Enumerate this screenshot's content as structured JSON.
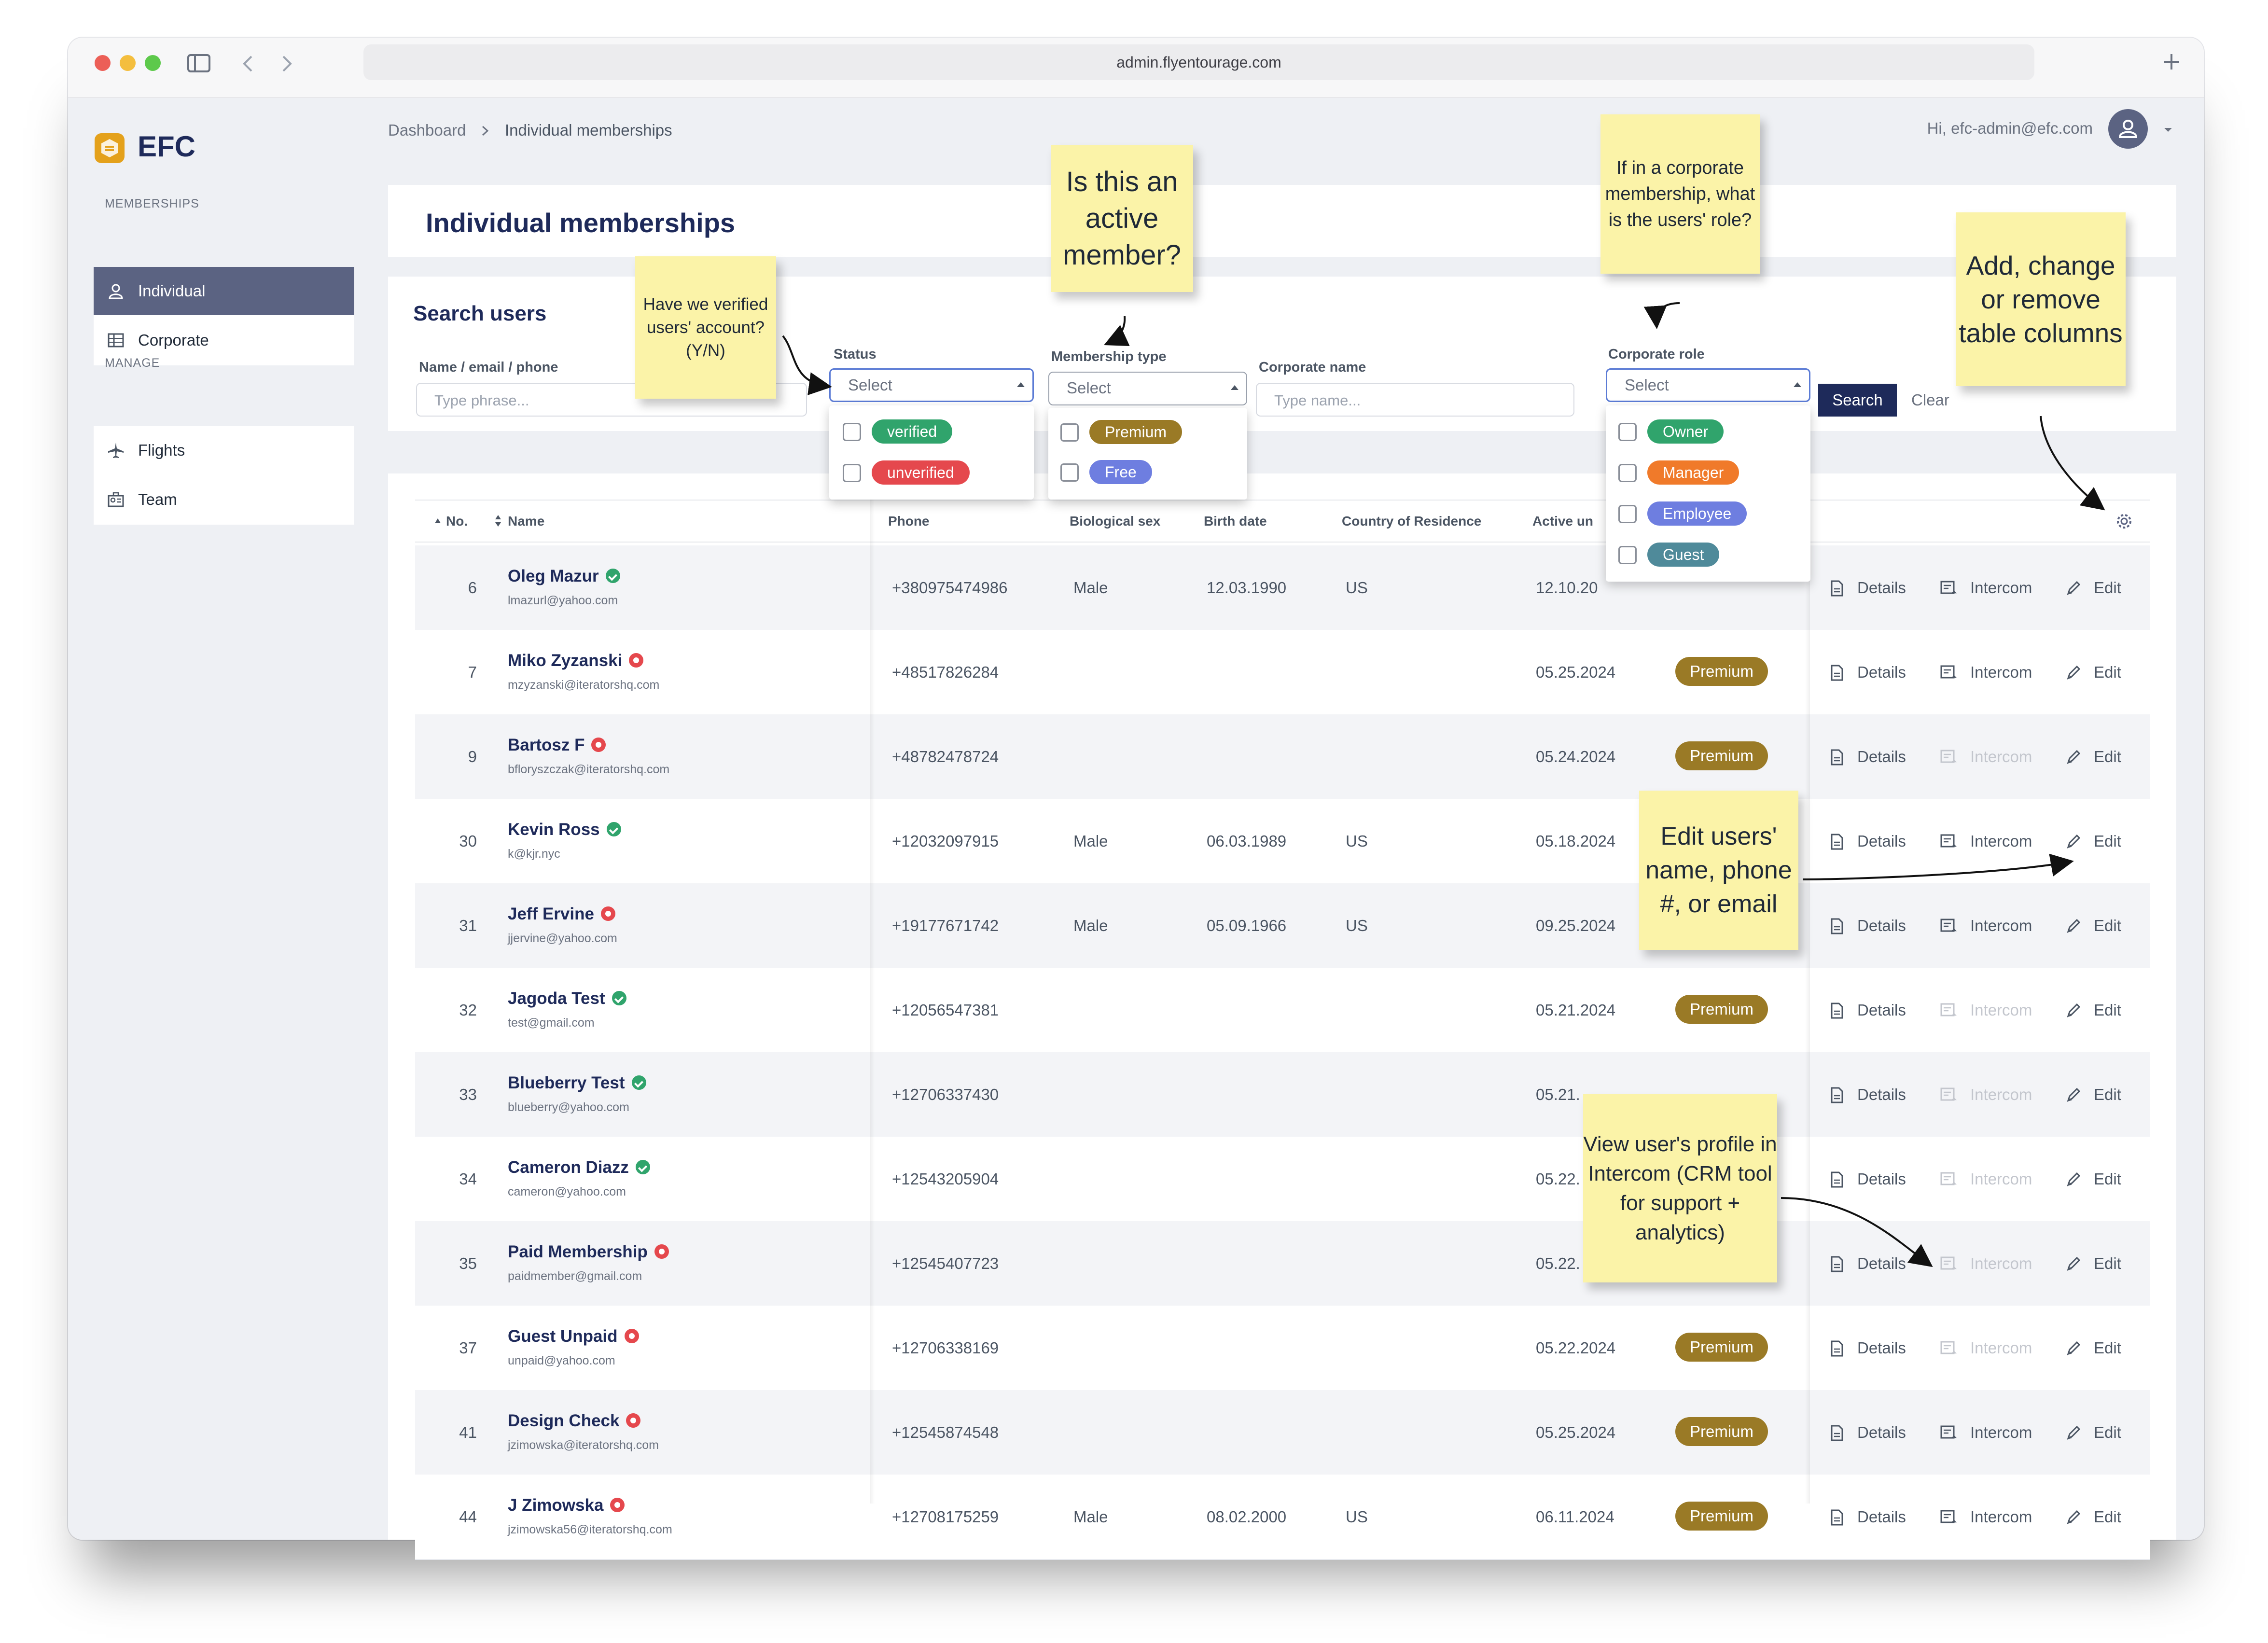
{
  "browser": {
    "url": "admin.flyentourage.com"
  },
  "brand": {
    "name": "EFC"
  },
  "sidebar": {
    "memberships_caption": "MEMBERSHIPS",
    "manage_caption": "MANAGE",
    "items": [
      {
        "label": "Individual",
        "icon": "person-icon",
        "active": true
      },
      {
        "label": "Corporate",
        "icon": "building-icon",
        "active": false
      },
      {
        "label": "Flights",
        "icon": "plane-icon",
        "active": false
      },
      {
        "label": "Team",
        "icon": "team-icon",
        "active": false
      }
    ]
  },
  "header": {
    "breadcrumb": [
      "Dashboard",
      "Individual memberships"
    ],
    "greeting": "Hi, efc-admin@efc.com"
  },
  "page": {
    "title": "Individual memberships"
  },
  "search": {
    "title": "Search users",
    "name_label": "Name / email / phone",
    "name_placeholder": "Type phrase...",
    "status_label": "Status",
    "status_value": "Select",
    "membership_label": "Membership type",
    "membership_value": "Select",
    "corporate_name_label": "Corporate name",
    "corporate_name_placeholder": "Type name...",
    "corporate_role_label": "Corporate role",
    "corporate_role_value": "Select",
    "search_button": "Search",
    "clear_button": "Clear"
  },
  "dropdowns": {
    "status": [
      {
        "label": "verified",
        "color": "#30a46c"
      },
      {
        "label": "unverified",
        "color": "#e5484d"
      }
    ],
    "membership": [
      {
        "label": "Premium",
        "color": "#9a7a26"
      },
      {
        "label": "Free",
        "color": "#6e7ee0"
      }
    ],
    "corporate_role": [
      {
        "label": "Owner",
        "color": "#30a46c"
      },
      {
        "label": "Manager",
        "color": "#f07a2a"
      },
      {
        "label": "Employee",
        "color": "#6e7ee0"
      },
      {
        "label": "Guest",
        "color": "#4f8a9a"
      }
    ]
  },
  "table": {
    "columns": [
      "No.",
      "Name",
      "Phone",
      "Biological sex",
      "Birth date",
      "Country of Residence",
      "Active un"
    ],
    "actions": {
      "details": "Details",
      "intercom": "Intercom",
      "edit": "Edit"
    },
    "rows": [
      {
        "no": "6",
        "name": "Oleg Mazur",
        "email": "lmazurl@yahoo.com",
        "verified": true,
        "phone": "+380975474986",
        "sex": "Male",
        "birth": "12.03.1990",
        "country": "US",
        "active": "12.10.20",
        "membership": "",
        "intercom": true
      },
      {
        "no": "7",
        "name": "Miko Zyzanski",
        "email": "mzyzanski@iteratorshq.com",
        "verified": false,
        "phone": "+48517826284",
        "sex": "",
        "birth": "",
        "country": "",
        "active": "05.25.2024",
        "membership": "Premium",
        "intercom": true
      },
      {
        "no": "9",
        "name": "Bartosz F",
        "email": "bfloryszczak@iteratorshq.com",
        "verified": false,
        "phone": "+48782478724",
        "sex": "",
        "birth": "",
        "country": "",
        "active": "05.24.2024",
        "membership": "Premium",
        "intercom": false
      },
      {
        "no": "30",
        "name": "Kevin Ross",
        "email": "k@kjr.nyc",
        "verified": true,
        "phone": "+12032097915",
        "sex": "Male",
        "birth": "06.03.1989",
        "country": "US",
        "active": "05.18.2024",
        "membership": "",
        "intercom": true
      },
      {
        "no": "31",
        "name": "Jeff Ervine",
        "email": "jjervine@yahoo.com",
        "verified": false,
        "phone": "+19177671742",
        "sex": "Male",
        "birth": "05.09.1966",
        "country": "US",
        "active": "09.25.2024",
        "membership": "",
        "intercom": true
      },
      {
        "no": "32",
        "name": "Jagoda Test",
        "email": "test@gmail.com",
        "verified": true,
        "phone": "+12056547381",
        "sex": "",
        "birth": "",
        "country": "",
        "active": "05.21.2024",
        "membership": "Premium",
        "intercom": false
      },
      {
        "no": "33",
        "name": "Blueberry Test",
        "email": "blueberry@yahoo.com",
        "verified": true,
        "phone": "+12706337430",
        "sex": "",
        "birth": "",
        "country": "",
        "active": "05.21.",
        "membership": "",
        "intercom": false
      },
      {
        "no": "34",
        "name": "Cameron Diazz",
        "email": "cameron@yahoo.com",
        "verified": true,
        "phone": "+12543205904",
        "sex": "",
        "birth": "",
        "country": "",
        "active": "05.22.",
        "membership": "",
        "intercom": false
      },
      {
        "no": "35",
        "name": "Paid Membership",
        "email": "paidmember@gmail.com",
        "verified": false,
        "phone": "+12545407723",
        "sex": "",
        "birth": "",
        "country": "",
        "active": "05.22.",
        "membership": "",
        "intercom": false
      },
      {
        "no": "37",
        "name": "Guest Unpaid",
        "email": "unpaid@yahoo.com",
        "verified": false,
        "phone": "+12706338169",
        "sex": "",
        "birth": "",
        "country": "",
        "active": "05.22.2024",
        "membership": "Premium",
        "intercom": false
      },
      {
        "no": "41",
        "name": "Design Check",
        "email": "jzimowska@iteratorshq.com",
        "verified": false,
        "phone": "+12545874548",
        "sex": "",
        "birth": "",
        "country": "",
        "active": "05.25.2024",
        "membership": "Premium",
        "intercom": true
      },
      {
        "no": "44",
        "name": "J Zimowska",
        "email": "jzimowska56@iteratorshq.com",
        "verified": false,
        "phone": "+12708175259",
        "sex": "Male",
        "birth": "08.02.2000",
        "country": "US",
        "active": "06.11.2024",
        "membership": "Premium",
        "intercom": true
      }
    ]
  },
  "annotations": {
    "verified": "Have we verified users' account? (Y/N)",
    "active": "Is this an active member?",
    "corporate_role": "If in a corporate membership, what is the users' role?",
    "columns": "Add, change or remove table columns",
    "edit": "Edit users' name, phone #, or email",
    "intercom": "View user's profile in Intercom (CRM tool for support + analytics)"
  }
}
